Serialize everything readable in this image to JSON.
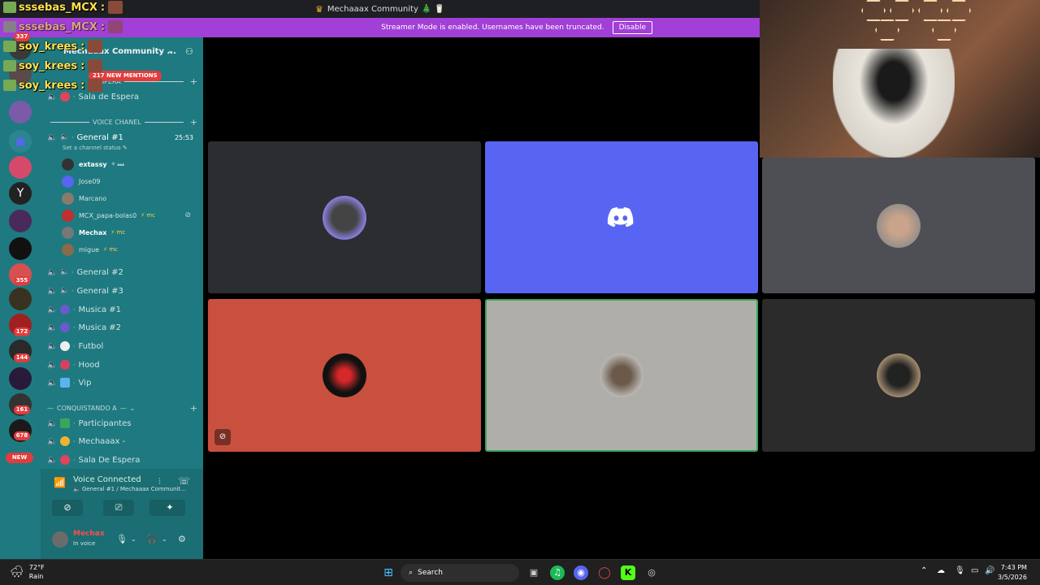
{
  "window": {
    "title": "Mechaaax Community",
    "title_decor": "🎄 🥛"
  },
  "banner": {
    "text": "Streamer Mode is enabled. Usernames have been truncated.",
    "button": "Disable"
  },
  "server": {
    "name": "Mechaaax Community ..."
  },
  "mentions": "217 NEW MENTIONS",
  "rail": {
    "badges": [
      "337",
      "355",
      "172",
      "144",
      "161",
      "678"
    ],
    "new_label": "NEW"
  },
  "categories": {
    "espera": "ESPERA",
    "voice": "VOICE CHANEL",
    "conquistando": "CONQUISTANDO A"
  },
  "channels": {
    "sala_espera": "Sala de Espera",
    "general1": "General #1",
    "general1_timer": "25:53",
    "status_hint": "Set a channel status",
    "general2": "General #2",
    "general3": "General #3",
    "musica1": "Musica #1",
    "musica2": "Musica #2",
    "futbol": "Futbol",
    "hood": "Hood",
    "vip": "Vip",
    "participantes": "Participantes",
    "mechaaax": "Mechaaax -",
    "sala_espera2": "Sala De Espera"
  },
  "members": [
    {
      "name": "extassy",
      "tag": "✧ 𝓼𝓼𝓼"
    },
    {
      "name": "Jose09",
      "tag": ""
    },
    {
      "name": "Marcano",
      "tag": ""
    },
    {
      "name": "MCX_papa-bolas0",
      "tag": "⚡ mc"
    },
    {
      "name": "Mechax",
      "tag": "⚡ mc"
    },
    {
      "name": "migue",
      "tag": "⚡ mc"
    }
  ],
  "voice_panel": {
    "title": "Voice Connected",
    "subtitle": "General #1 / Mechaaax Communit..."
  },
  "user": {
    "name": "Mechax",
    "status": "In voice"
  },
  "chat": [
    {
      "user": "sssebas_MCX",
      "sep": ":"
    },
    {
      "user": "sssebas_MCX",
      "sep": ":"
    },
    {
      "user": "soy_krees",
      "sep": ":"
    },
    {
      "user": "soy_krees",
      "sep": ":"
    },
    {
      "user": "soy_krees",
      "sep": ":"
    }
  ],
  "taskbar": {
    "temp": "72°F",
    "weather": "Rain",
    "search": "Search",
    "time": "7:43 PM",
    "date": "3/5/2026"
  },
  "colors": {
    "accent": "#a13fd6",
    "sidebar": "#1e7a80",
    "discord_blurple": "#5865f2",
    "tile_red": "#c9503f",
    "tile_gray": "#b0aea8"
  }
}
